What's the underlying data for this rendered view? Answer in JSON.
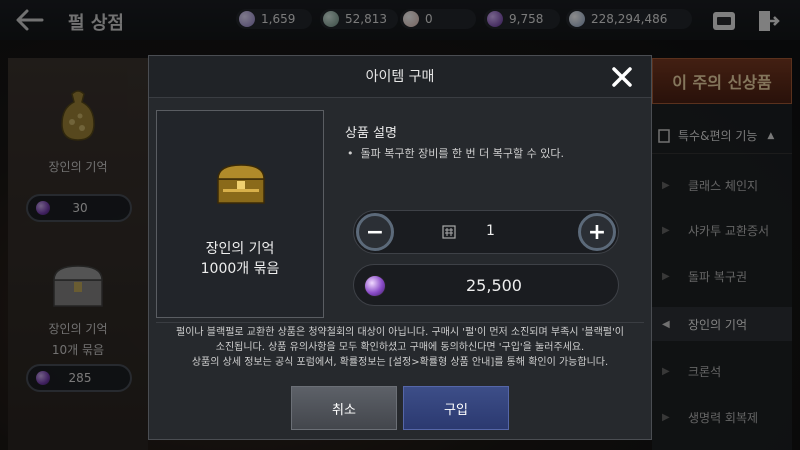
{
  "topbar": {
    "title": "펄 상점",
    "currencies": [
      {
        "value": "1,659",
        "icon": "m-coin-icon",
        "color": "#b8a8d8"
      },
      {
        "value": "52,813",
        "icon": "silver-coin-icon",
        "color": "#8fb8a8"
      },
      {
        "value": "0",
        "icon": "pearl-icon",
        "color": "#f0d8d0"
      },
      {
        "value": "9,758",
        "icon": "purple-gem-icon",
        "color": "#7a3fb8"
      },
      {
        "value": "228,294,486",
        "icon": "silver-icon",
        "color": "#b8c8e0"
      }
    ]
  },
  "left_list": {
    "items": [
      {
        "name": "장인의 기억",
        "price": "30"
      },
      {
        "name": "장인의 기억",
        "subname": "10개 묶음",
        "price": "285"
      }
    ]
  },
  "right_list": {
    "banner": "이 주의 신상품",
    "category": "특수&편의 기능",
    "items": [
      {
        "label": "클래스 체인지",
        "active": false
      },
      {
        "label": "샤카투 교환증서",
        "active": false
      },
      {
        "label": "돌파 복구권",
        "active": false
      },
      {
        "label": "장인의 기억",
        "active": true
      },
      {
        "label": "크론석",
        "active": false
      },
      {
        "label": "생명력 회복제",
        "active": false
      }
    ]
  },
  "modal": {
    "title": "아이템 구매",
    "item_name": "장인의 기억",
    "item_bundle": "1000개 묶음",
    "desc_title": "상품 설명",
    "desc_text": "돌파 복구한 장비를 한 번 더 복구할 수 있다.",
    "quantity": "1",
    "total_price": "25,500",
    "notice_line1": "펄이나 블랙펄로 교환한 상품은 청약철회의 대상이 아닙니다. 구매시 '펄'이 먼저 소진되며 부족시 '블랙펄'이",
    "notice_line2": "소진됩니다. 상품 유의사항을 모두 확인하셨고 구매에 동의하신다면 '구입'을 눌러주세요.",
    "notice_line3": "상품의 상세 정보는 공식 포럼에서, 확률정보는 [설정>확률형 상품 안내]를 통해 확인이 가능합니다.",
    "cancel_label": "취소",
    "buy_label": "구입"
  },
  "colors": {
    "accent_buy": "#2b3970",
    "banner": "#7a3a22"
  }
}
